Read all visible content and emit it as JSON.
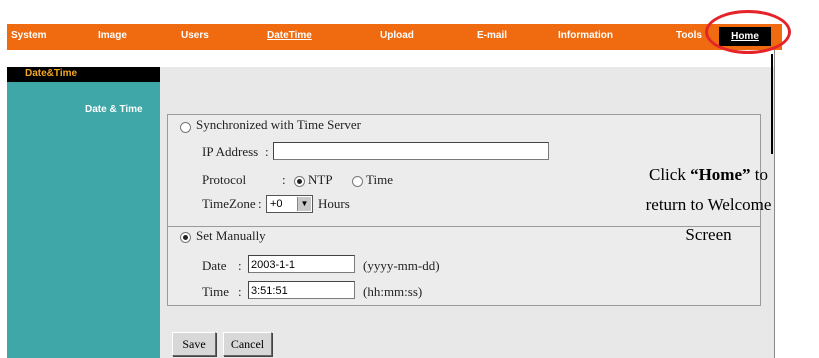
{
  "nav": {
    "items": [
      "System",
      "Image",
      "Users",
      "DateTime",
      "Upload",
      "E-mail",
      "Information",
      "Tools"
    ],
    "home": "Home",
    "active": "DateTime",
    "bg_color": "#f06a10"
  },
  "sidebar": {
    "header": "Date&Time",
    "label": "Date & Time",
    "color": "#3fa7a7"
  },
  "sync": {
    "label": "Synchronized with Time Server",
    "ip_label": "IP Address",
    "ip_value": "",
    "protocol_label": "Protocol",
    "protocol_options": [
      "NTP",
      "Time"
    ],
    "protocol_selected": "NTP",
    "timezone_label": "TimeZone",
    "timezone_value": "+0",
    "timezone_unit": "Hours"
  },
  "manual": {
    "label": "Set Manually",
    "selected": true,
    "date_label": "Date",
    "date_value": "2003-1-1",
    "date_format": "(yyyy-mm-dd)",
    "time_label": "Time",
    "time_value": "3:51:51",
    "time_format": "(hh:mm:ss)"
  },
  "buttons": {
    "save": "Save",
    "cancel": "Cancel"
  },
  "annotation": {
    "pre": "Click",
    "bold": "“Home”",
    "post": "to",
    "line2": "return to Welcome",
    "line3": "Screen",
    "ring_color": "#e5242a"
  }
}
